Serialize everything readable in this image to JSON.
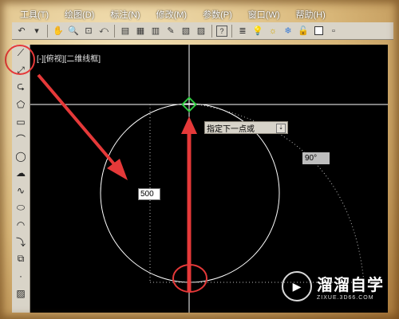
{
  "menu": {
    "items": [
      "工具(T)",
      "绘图(D)",
      "标注(N)",
      "修改(M)",
      "参数(P)",
      "窗口(W)",
      "帮助(H)"
    ]
  },
  "toolbar": {
    "icons": [
      "undo-icon",
      "pan-hand-icon",
      "zoom-realtime-icon",
      "zoom-window-icon",
      "zoom-previous-icon",
      "properties-icon",
      "design-center-icon",
      "tool-palettes-icon",
      "markup-icon",
      "quickcalc-icon",
      "help-icon",
      "layer-properties-icon",
      "bulb-icon",
      "sun-icon",
      "lock-icon",
      "color-square-icon"
    ],
    "help_label": "?"
  },
  "palette": {
    "tools": [
      "line-icon",
      "construction-line-icon",
      "polyline-icon",
      "polygon-icon",
      "rectangle-icon",
      "arc-icon",
      "circle-icon",
      "revision-cloud-icon",
      "spline-icon",
      "ellipse-icon",
      "ellipse-arc-icon",
      "insert-block-icon",
      "make-block-icon",
      "point-icon",
      "hatch-icon"
    ]
  },
  "canvas": {
    "viewport_label": "[-][俯视][二维线框]",
    "prompt_text": "指定下一点或",
    "prompt_button": "⇣",
    "angle_text": "90°",
    "length_input_value": "500"
  },
  "watermark": {
    "title": "溜溜自学",
    "subtitle": "ZIXUE.3D66.COM"
  },
  "colors": {
    "canvas_bg": "#000000",
    "crosshair": "#ffffff",
    "annotation_red": "#e53939",
    "snap_marker": "#2ecc40"
  }
}
